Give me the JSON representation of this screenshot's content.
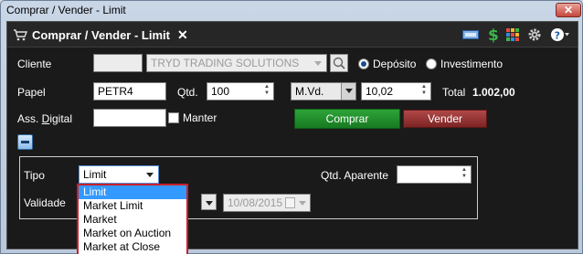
{
  "window": {
    "title": "Comprar / Vender - Limit",
    "close_glyph": "✕"
  },
  "tab": {
    "title": "Comprar / Vender - Limit",
    "close_glyph": "✕"
  },
  "header_icons": [
    "cash-icon",
    "dollar-icon",
    "grid-icon",
    "gear-icon",
    "help-icon"
  ],
  "cliente": {
    "label": "Cliente",
    "code": "",
    "name": "TRYD TRADING SOLUTIONS",
    "radio_deposito": "Depósito",
    "radio_investimento": "Investimento",
    "selected_radio": "Depósito"
  },
  "papel": {
    "label": "Papel",
    "symbol": "PETR4",
    "qtd_label": "Qtd.",
    "qtd_value": "100",
    "price_mode": "M.Vd.",
    "price_value": "10,02",
    "total_label": "Total",
    "total_value": "1.002,00"
  },
  "assinatura": {
    "label": "Ass. Digital",
    "value": "",
    "manter_label": "Manter"
  },
  "buttons": {
    "comprar": "Comprar",
    "vender": "Vender"
  },
  "order": {
    "tipo_label": "Tipo",
    "tipo_value": "Limit",
    "qtd_aparente_label": "Qtd. Aparente",
    "qtd_aparente_value": "",
    "validade_label": "Validade",
    "validade_date": "10/08/2015"
  },
  "tipo_options": [
    "Limit",
    "Market Limit",
    "Market",
    "Market on Auction",
    "Market at Close"
  ],
  "tipo_selected_index": 0,
  "colors": {
    "buy": "#1f8f2c",
    "sell": "#8e2f2f",
    "highlight": "#3399ff",
    "dropdown_border": "#c8202a",
    "background": "#1a1a1a"
  }
}
